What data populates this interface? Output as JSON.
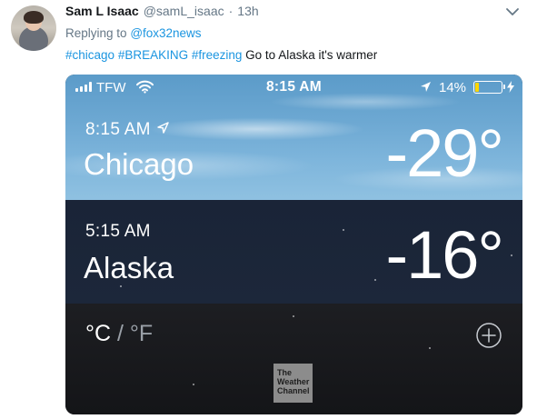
{
  "tweet": {
    "display_name": "Sam L Isaac",
    "handle": "@samL_isaac",
    "separator": "·",
    "time": "13h",
    "replying_to_prefix": "Replying to",
    "replying_to_handle": "@fox32news",
    "hashtags": [
      "#chicago",
      "#BREAKING",
      "#freezing"
    ],
    "text": "Go to Alaska it's warmer"
  },
  "phone": {
    "status_bar": {
      "carrier": "TFW",
      "time": "8:15 AM",
      "battery_percent": "14%",
      "battery_level": 0.14,
      "battery_color": "#ffd600",
      "icons": [
        "signal-icon",
        "wifi-icon",
        "location-icon",
        "battery-icon",
        "charging-bolt-icon"
      ]
    },
    "locations": [
      {
        "time": "8:15 AM",
        "city": "Chicago",
        "temperature": "-29°",
        "current_location": true
      },
      {
        "time": "5:15 AM",
        "city": "Alaska",
        "temperature": "-16°",
        "current_location": false
      }
    ],
    "units": {
      "celsius": "°C",
      "slash": "/",
      "fahrenheit": "°F"
    },
    "logo": {
      "line1": "The",
      "line2": "Weather",
      "line3": "Channel"
    }
  },
  "colors": {
    "link_blue": "#1b95e0",
    "text_dark": "#14171a",
    "text_gray": "#657786",
    "chicago_sky": "#6ea9d3",
    "alaska_panel": "#1c273a"
  }
}
